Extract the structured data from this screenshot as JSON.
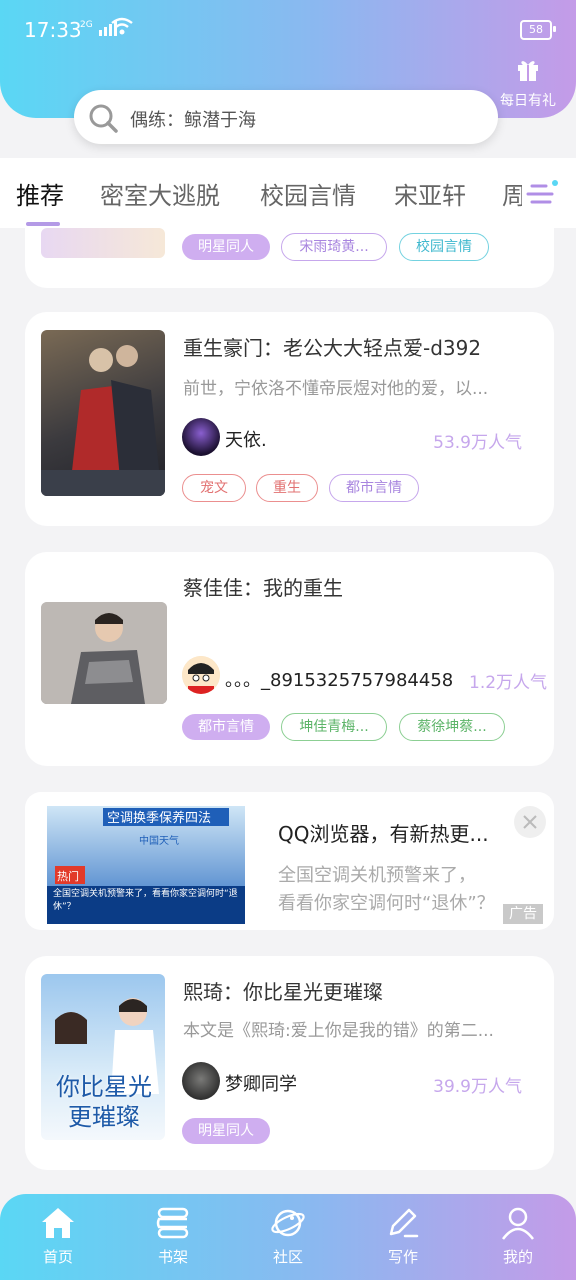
{
  "status": {
    "time": "17:33",
    "signal": "2G",
    "battery": "58"
  },
  "header": {
    "gift_label": "每日有礼"
  },
  "search": {
    "placeholder": "偶练：鲸潜于海"
  },
  "tabs": [
    "推荐",
    "密室大逃脱",
    "校园言情",
    "宋亚轩",
    "周深"
  ],
  "cards": [
    {
      "tags": [
        "明星同人",
        "宋雨琦黄...",
        "校园言情"
      ]
    },
    {
      "title": "重生豪门：老公大大轻点爱-d392",
      "desc": "前世，宁依洛不懂帝辰煜对他的爱，以...",
      "author": "天依.",
      "popularity": "53.9万人气",
      "tags": [
        "宠文",
        "重生",
        "都市言情"
      ]
    },
    {
      "title": "蔡佳佳：我的重生",
      "author": "。。。_8915325757984458",
      "popularity": "1.2万人气",
      "tags": [
        "都市言情",
        "坤佳青梅...",
        "蔡徐坤蔡..."
      ]
    },
    {
      "title": "熙琦：你比星光更璀璨",
      "desc": "本文是《熙琦:爱上你是我的错》的第二...",
      "author": "梦卿同学",
      "popularity": "39.9万人气",
      "tags": [
        "明星同人"
      ],
      "cover_text": "你比星光更璀璨"
    }
  ],
  "ad": {
    "title": "QQ浏览器，有新热更...",
    "desc_line1": "全国空调关机预警来了，",
    "desc_line2": "看看你家空调何时“退休”？",
    "badge": "广告",
    "img_banner": "空调换季保养四法",
    "img_hot": "热门",
    "img_caption": "全国空调关机预警来了，看看你家空调何时“退休”？",
    "img_source": "中国天气"
  },
  "nav": [
    {
      "label": "首页",
      "icon": "home-icon"
    },
    {
      "label": "书架",
      "icon": "bookshelf-icon"
    },
    {
      "label": "社区",
      "icon": "community-icon"
    },
    {
      "label": "写作",
      "icon": "write-icon"
    },
    {
      "label": "我的",
      "icon": "profile-icon"
    }
  ],
  "colors": {
    "header_start": "#5ad7f4",
    "header_end": "#c49be8",
    "accent": "#c6a7ec"
  }
}
